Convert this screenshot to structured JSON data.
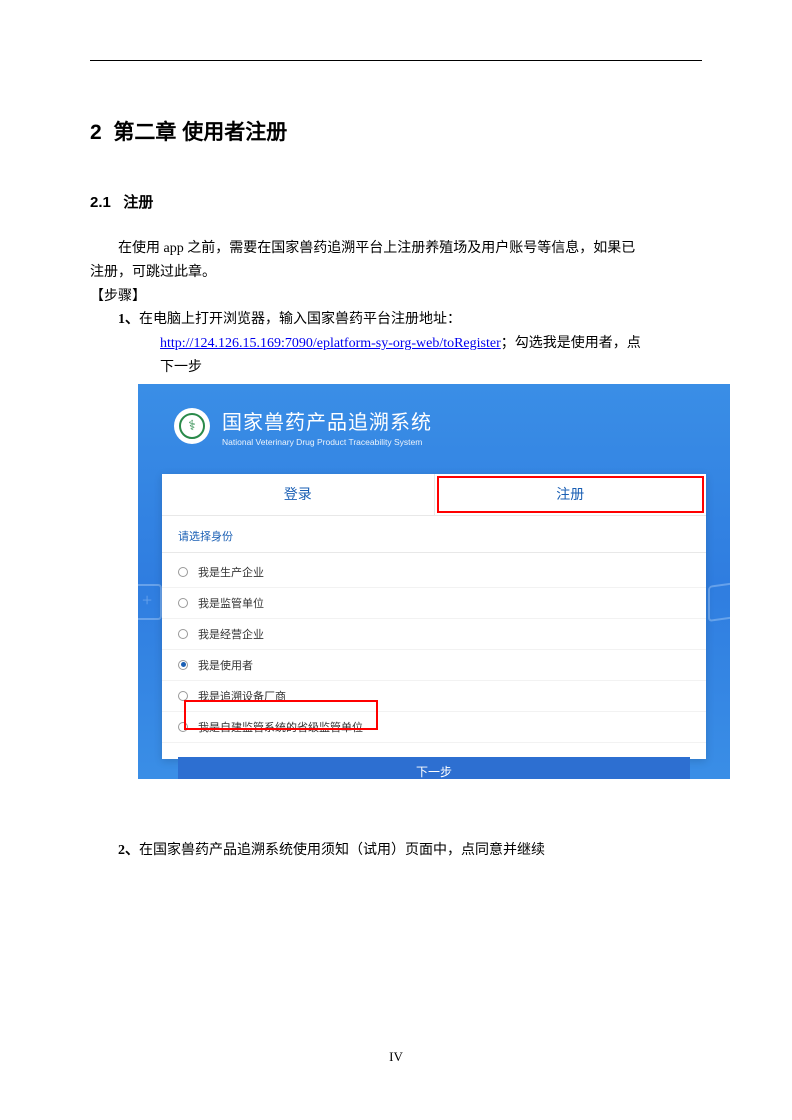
{
  "chapter": {
    "num": "2",
    "title": "第二章 使用者注册"
  },
  "section": {
    "num": "2.1",
    "title": "注册"
  },
  "intro_line1": "在使用 app 之前，需要在国家兽药追溯平台上注册养殖场及用户账号等信息，如果已",
  "intro_line2": "注册，可跳过此章。",
  "steps_label": "【步骤】",
  "step1": {
    "num": "1、",
    "text": "在电脑上打开浏览器，输入国家兽药平台注册地址：",
    "url": "http://124.126.15.169:7090/eplatform-sy-org-web/toRegister",
    "after_url": "；勾选我是使用者，点",
    "line3": "下一步"
  },
  "screenshot": {
    "system_title_cn": "国家兽药产品追溯系统",
    "system_title_en": "National Veterinary Drug Product Traceability System",
    "tab_login": "登录",
    "tab_register": "注册",
    "prompt": "请选择身份",
    "options": [
      {
        "label": "我是生产企业",
        "checked": false
      },
      {
        "label": "我是监管单位",
        "checked": false
      },
      {
        "label": "我是经营企业",
        "checked": false
      },
      {
        "label": "我是使用者",
        "checked": true
      },
      {
        "label": "我是追溯设备厂商",
        "checked": false
      },
      {
        "label": "我是自建监管系统的省级监管单位",
        "checked": false
      }
    ],
    "next_btn": "下一步"
  },
  "step2": {
    "num": "2、",
    "text": "在国家兽药产品追溯系统使用须知（试用）页面中，点同意并继续"
  },
  "page_number": "IV"
}
